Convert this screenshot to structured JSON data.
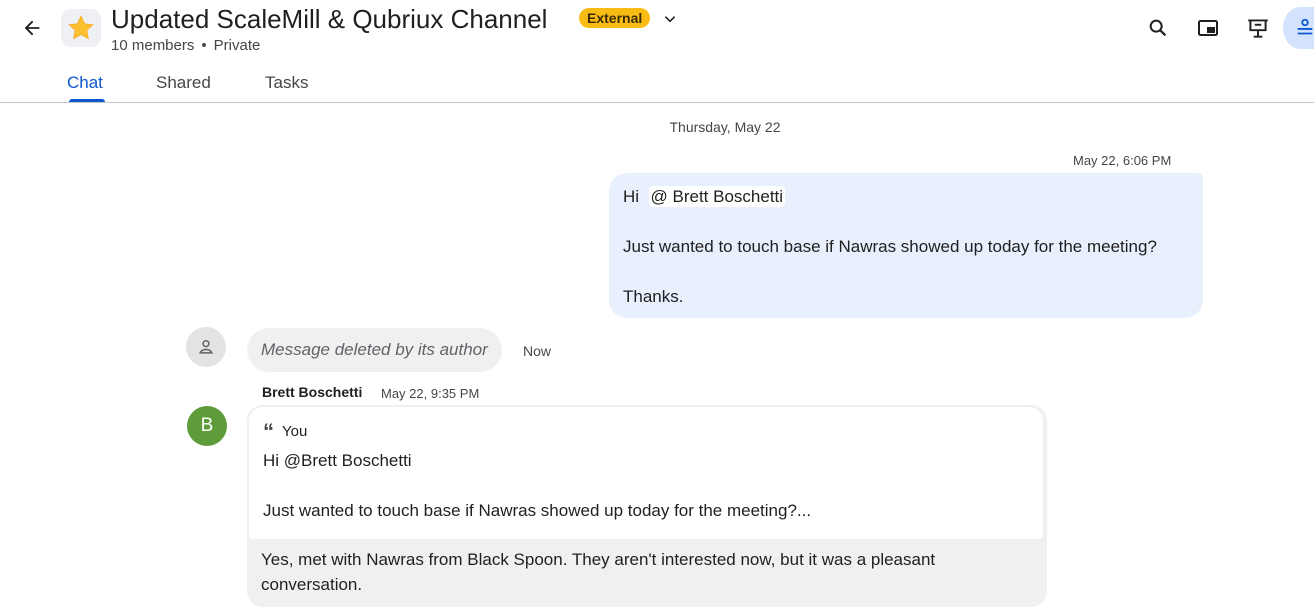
{
  "header": {
    "title": "Updated ScaleMill & Qubriux Channel",
    "badge": "External",
    "members": "10 members",
    "separator": "•",
    "privacy": "Private",
    "icons": [
      "back-arrow-icon",
      "star-icon",
      "chevron-down-icon",
      "search-icon",
      "picture-in-picture-icon",
      "present-icon",
      "side-panel-icon"
    ]
  },
  "tabs": [
    {
      "label": "Chat",
      "selected": true
    },
    {
      "label": "Shared",
      "selected": false
    },
    {
      "label": "Tasks",
      "selected": false
    }
  ],
  "messages": {
    "date_separator": "Thursday, May 22",
    "mine": {
      "time": "May 22, 6:06 PM",
      "greeting_prefix": "Hi",
      "mention": "@ Brett Boschetti",
      "line2": "Just wanted to touch base if Nawras showed up today for the meeting?",
      "line3": "Thanks."
    },
    "deleted": {
      "text": "Message deleted by its author",
      "time": "Now"
    },
    "reply": {
      "sender": "Brett Boschetti",
      "time": "May 22, 9:35 PM",
      "avatar_letter": "B",
      "quote_author": "You",
      "quote_line1": "Hi @Brett Boschetti",
      "quote_line2": "Just wanted to touch base if Nawras showed up today for the meeting?...",
      "text": "Yes, met with Nawras from Black Spoon. They aren't interested now, but it was a pleasant conversation."
    }
  },
  "colors": {
    "accent": "#0b57d0",
    "badge": "#f9bc15",
    "my_bubble": "#e8effd",
    "avatar_b": "#5e9c3a"
  }
}
